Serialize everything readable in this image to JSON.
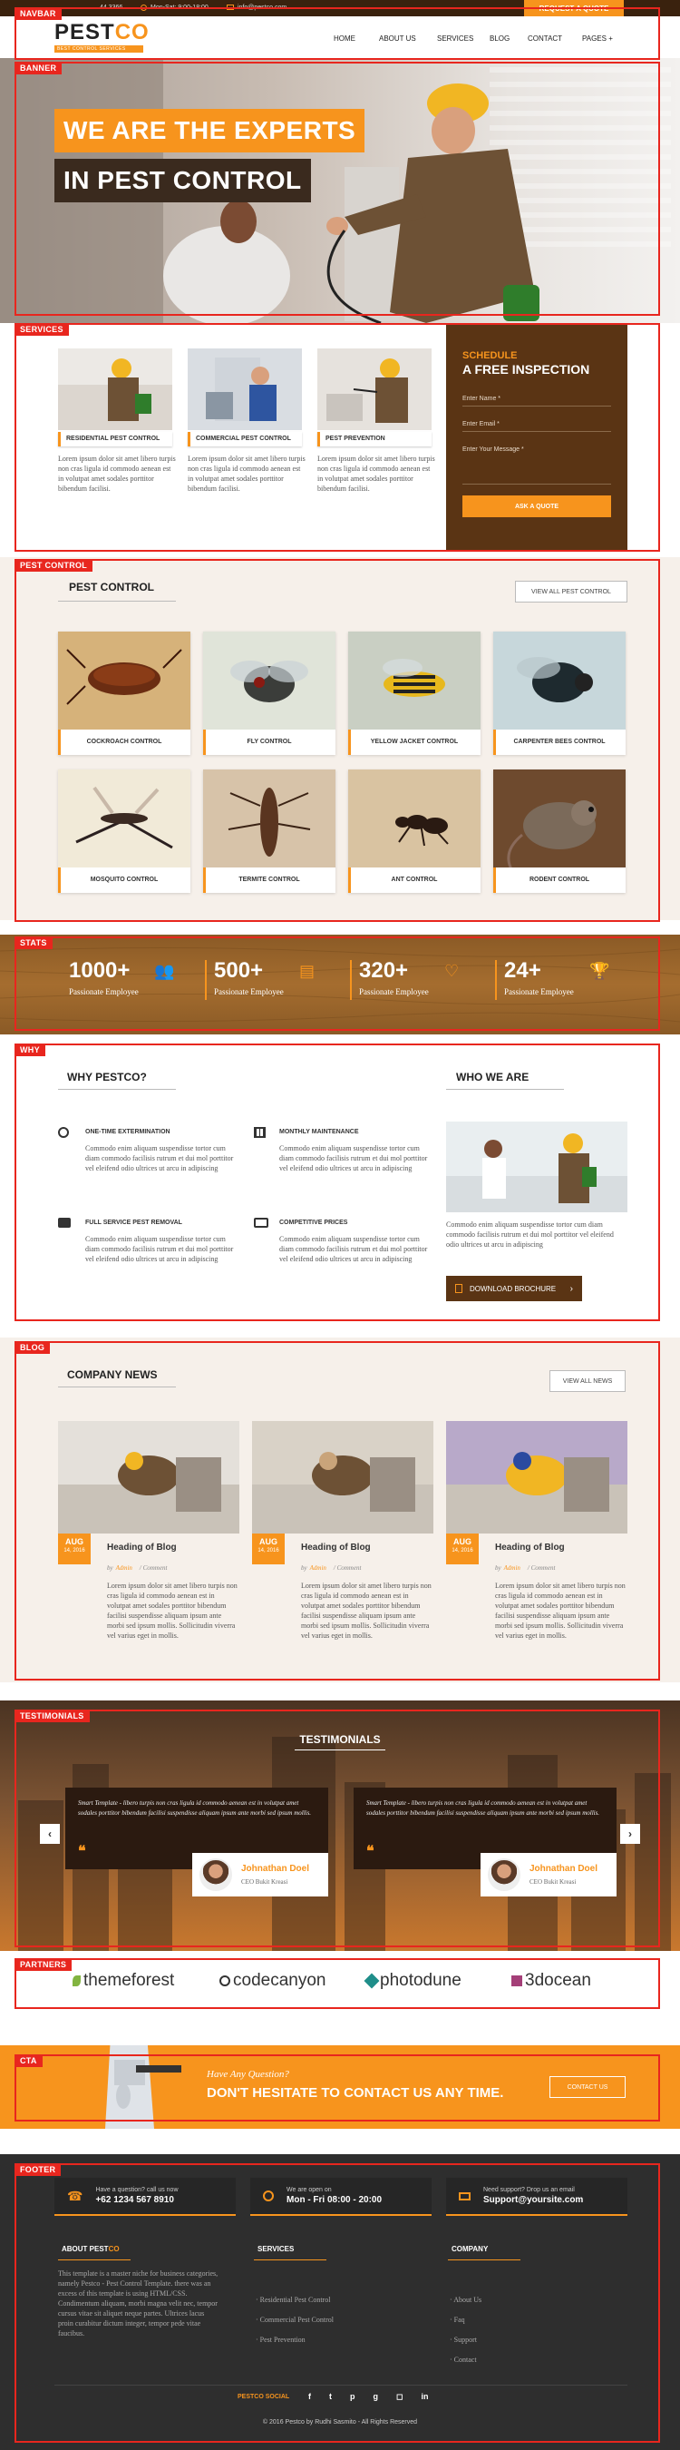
{
  "labels": {
    "navbar": "NAVBAR",
    "banner": "BANNER",
    "services": "SERVICES",
    "pest": "PEST CONTROL",
    "stats": "STATS",
    "why": "WHY",
    "blog": "BLOG",
    "testimonials": "TESTIMONIALS",
    "partners": "PARTNERS",
    "cta": "CTA",
    "footer": "FOOTER"
  },
  "topbar": {
    "phone": "44 3366",
    "hours": "Mon-Sat: 9:00-18:00",
    "email": "info@pestco.com",
    "quote_btn": "REQUEST A QUOTE"
  },
  "nav": {
    "logo_a": "PEST",
    "logo_b": "CO",
    "tagline": "BEST CONTROL SERVICES",
    "items": [
      "HOME",
      "ABOUT US",
      "SERVICES",
      "BLOG",
      "CONTACT",
      "PAGES +"
    ]
  },
  "banner": {
    "line1": "WE ARE THE EXPERTS",
    "line2": "IN PEST CONTROL"
  },
  "services": {
    "cards": [
      {
        "title": "RESIDENTIAL PEST CONTROL",
        "text": "Lorem ipsum dolor sit amet libero turpis non cras ligula id commodo aenean est in volutpat amet sodales porttitor bibendum facilisi."
      },
      {
        "title": "COMMERCIAL PEST CONTROL",
        "text": "Lorem ipsum dolor sit amet libero turpis non cras ligula id commodo aenean est in volutpat amet sodales porttitor bibendum facilisi."
      },
      {
        "title": "PEST PREVENTION",
        "text": "Lorem ipsum dolor sit amet libero turpis non cras ligula id commodo aenean est in volutpat amet sodales porttitor bibendum facilisi."
      }
    ],
    "schedule": {
      "kicker": "SCHEDULE",
      "title": "A FREE INSPECTION",
      "name": "Enter Name *",
      "email": "Enter Email *",
      "message": "Enter Your Message *",
      "button": "ASK A QUOTE"
    }
  },
  "pest": {
    "title": "PEST CONTROL",
    "view_all": "VIEW ALL PEST CONTROL",
    "items": [
      "COCKROACH CONTROL",
      "FLY CONTROL",
      "YELLOW JACKET CONTROL",
      "CARPENTER BEES CONTROL",
      "MOSQUITO CONTROL",
      "TERMITE CONTROL",
      "ANT CONTROL",
      "RODENT CONTROL"
    ]
  },
  "stats": [
    {
      "num": "1000+",
      "label": "Passionate Employee",
      "icon": "users-icon"
    },
    {
      "num": "500+",
      "label": "Passionate Employee",
      "icon": "document-icon"
    },
    {
      "num": "320+",
      "label": "Passionate Employee",
      "icon": "heart-icon"
    },
    {
      "num": "24+",
      "label": "Passionate Employee",
      "icon": "trophy-icon"
    }
  ],
  "why": {
    "title": "WHY PESTCO?",
    "who": "WHO WE ARE",
    "features": [
      {
        "title": "ONE-TIME EXTERMINATION",
        "text": "Commodo enim aliquam suspendisse tortor cum diam commodo facilisis rutrum et dui mol porttitor vel eleifend odio ultrices ut arcu in adipiscing"
      },
      {
        "title": "MONTHLY MAINTENANCE",
        "text": "Commodo enim aliquam suspendisse tortor cum diam commodo facilisis rutrum et dui mol porttitor vel eleifend odio ultrices ut arcu in adipiscing"
      },
      {
        "title": "FULL SERVICE PEST REMOVAL",
        "text": "Commodo enim aliquam suspendisse tortor cum diam commodo facilisis rutrum et dui mol porttitor vel eleifend odio ultrices ut arcu in adipiscing"
      },
      {
        "title": "COMPETITIVE PRICES",
        "text": "Commodo enim aliquam suspendisse tortor cum diam commodo facilisis rutrum et dui mol porttitor vel eleifend odio ultrices ut arcu in adipiscing"
      }
    ],
    "who_text": "Commodo enim aliquam suspendisse tortor cum diam commodo facilisis rutrum et dui mol porttitor vel eleifend odio ultrices ut arcu in adipiscing",
    "brochure": "DOWNLOAD BROCHURE"
  },
  "blog": {
    "title": "COMPANY NEWS",
    "view_all": "VIEW ALL NEWS",
    "posts": [
      {
        "month": "AUG",
        "day": "14, 2016",
        "title": "Heading of Blog",
        "by": "by",
        "author": "Admin",
        "comments": "/ Comment",
        "text": "Lorem ipsum dolor sit amet libero turpis non cras ligula id commodo aenean est in volutpat amet sodales porttitor bibendum facilisi suspendisse aliquam ipsum ante morbi sed ipsum mollis. Sollicitudin viverra vel varius eget in mollis."
      },
      {
        "month": "AUG",
        "day": "14, 2016",
        "title": "Heading of Blog",
        "by": "by",
        "author": "Admin",
        "comments": "/ Comment",
        "text": "Lorem ipsum dolor sit amet libero turpis non cras ligula id commodo aenean est in volutpat amet sodales porttitor bibendum facilisi suspendisse aliquam ipsum ante morbi sed ipsum mollis. Sollicitudin viverra vel varius eget in mollis."
      },
      {
        "month": "AUG",
        "day": "14, 2016",
        "title": "Heading of Blog",
        "by": "by",
        "author": "Admin",
        "comments": "/ Comment",
        "text": "Lorem ipsum dolor sit amet libero turpis non cras ligula id commodo aenean est in volutpat amet sodales porttitor bibendum facilisi suspendisse aliquam ipsum ante morbi sed ipsum mollis. Sollicitudin viverra vel varius eget in mollis."
      }
    ]
  },
  "testimonials": {
    "title": "TESTIMONIALS",
    "items": [
      {
        "quote": "Smart Template - libero turpis non cras ligula id commodo aenean est in volutpat amet sodales porttitor bibendum facilisi suspendisse aliquam ipsum ante morbi sed ipsum mollis.",
        "name": "Johnathan Doel",
        "role": "CEO Bukit Kreasi"
      },
      {
        "quote": "Smart Template - libero turpis non cras ligula id commodo aenean est in volutpat amet sodales porttitor bibendum facilisi suspendisse aliquam ipsum ante morbi sed ipsum mollis.",
        "name": "Johnathan Doel",
        "role": "CEO Bukit Kreasi"
      }
    ]
  },
  "partners": [
    "themeforest",
    "codecanyon",
    "photodune",
    "3docean"
  ],
  "cta": {
    "kicker": "Have Any Question?",
    "title": "DON'T HESITATE TO CONTACT US ANY TIME.",
    "button": "CONTACT US"
  },
  "footer": {
    "contacts": [
      {
        "label": "Have a question? call us now",
        "value": "+62 1234 567 8910"
      },
      {
        "label": "We are open on",
        "value": "Mon - Fri 08:00 - 20:00"
      },
      {
        "label": "Need support? Drop us an email",
        "value": "Support@yoursite.com"
      }
    ],
    "about_title_a": "ABOUT PEST",
    "about_title_b": "CO",
    "about_text": "This template is a master niche for business categories, namely Pestco - Pest Control Template. there was an excess of this template is using HTML/CSS. Condimentum aliquam, morbi magna velit nec, tempor cursus vitae sit aliquet neque partes. Ultrices lacus proin curabitur dictum integer, tempor pede vitae faucibus.",
    "services_title": "SERVICES",
    "services": [
      "Residential Pest Control",
      "Commercial Pest Control",
      "Pest Prevention"
    ],
    "company_title": "COMPANY",
    "company": [
      "About Us",
      "Faq",
      "Support",
      "Contact"
    ],
    "social_a": "PESTCO",
    "social_b": " SOCIAL",
    "copyright": "© 2016 Pestco by Rudhi Sasmito - All Rights Reserved"
  },
  "colors": {
    "accent": "#f7941d",
    "brown": "#5a3414",
    "red_label": "#e8261e"
  }
}
